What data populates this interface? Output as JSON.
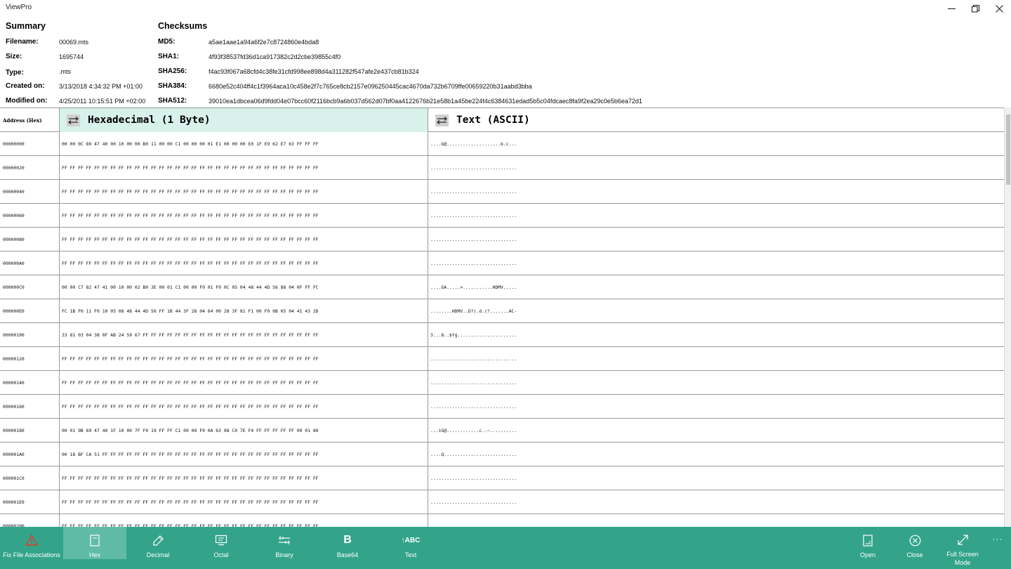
{
  "window": {
    "title": "ViewPro"
  },
  "summary": {
    "heading": "Summary",
    "fields": [
      {
        "label": "Filename:",
        "value": "00069.mts"
      },
      {
        "label": "Size:",
        "value": "1695744"
      },
      {
        "label": "Type:",
        "value": ".mts"
      },
      {
        "label": "Created on:",
        "value": "3/13/2018 4:34:32 PM +01:00"
      },
      {
        "label": "Modified on:",
        "value": "4/25/2011 10:15:51 PM +02:00"
      }
    ]
  },
  "checksums": {
    "heading": "Checksums",
    "fields": [
      {
        "label": "MD5:",
        "value": "a5ae1aae1a94a6f2e7c8724860e4bda8"
      },
      {
        "label": "SHA1:",
        "value": "4f93f38537fd36d1ca917382c2d2cbe39855c4f0"
      },
      {
        "label": "SHA256:",
        "value": "f4ac93f067a68cfd4c38fe31cfd998ee898d4a311282f547afe2e437cb81b324"
      },
      {
        "label": "SHA384:",
        "value": "6680e52c404ff4c1f3964aca10c458e2f7c765ce8cb2157e096250445cac4670da732b6709ffe00659220b31aabd3bba"
      },
      {
        "label": "SHA512:",
        "value": "39010ea1dbcea06d9fdd04e07bcc60f2116bcb9a6b037d562d07bf0aa4122676b21e58b1a45be224f4c6384631edad5b5c04fdcaec8fa9f2ea29c0e5b6ea72d1"
      }
    ]
  },
  "grid": {
    "address_header": "Address (Hex)",
    "hex_header": "Hexadecimal (1 Byte)",
    "text_header": "Text (ASCII)",
    "rows": [
      {
        "addr": "00000000",
        "hex": "00 00 0C 89 47 40 00 10 00 00 B0 11 00 00 C1 00 00 00 01 E1 00 00 00 E0 1F E9 62 E7 63 FF FF FF",
        "text": "....G@....................b.c..."
      },
      {
        "addr": "00000020",
        "hex": "FF FF FF FF FF FF FF FF FF FF FF FF FF FF FF FF FF FF FF FF FF FF FF FF FF FF FF FF FF FF FF FF",
        "text": "................................"
      },
      {
        "addr": "00000040",
        "hex": "FF FF FF FF FF FF FF FF FF FF FF FF FF FF FF FF FF FF FF FF FF FF FF FF FF FF FF FF FF FF FF FF",
        "text": "................................"
      },
      {
        "addr": "00000060",
        "hex": "FF FF FF FF FF FF FF FF FF FF FF FF FF FF FF FF FF FF FF FF FF FF FF FF FF FF FF FF FF FF FF FF",
        "text": "................................"
      },
      {
        "addr": "00000080",
        "hex": "FF FF FF FF FF FF FF FF FF FF FF FF FF FF FF FF FF FF FF FF FF FF FF FF FF FF FF FF FF FF FF FF",
        "text": "................................"
      },
      {
        "addr": "000000A0",
        "hex": "FF FF FF FF FF FF FF FF FF FF FF FF FF FF FF FF FF FF FF FF FF FF FF FF FF FF FF FF FF FF FF FF",
        "text": "................................"
      },
      {
        "addr": "000000C0",
        "hex": "00 00 C7 82 47 41 00 10 00 02 B0 3E 00 01 C1 00 00 F0 01 F0 0C 05 04 48 44 4D 56 88 04 0F FF FC",
        "text": "....GA.....>...........HDMV....."
      },
      {
        "addr": "000000E0",
        "hex": "FC 1B F0 11 F0 10 05 08 48 44 4D 56 FF 1B 44 3F 28 04 64 00 28 3F 81 F1 00 F0 0B 05 04 41 43 2D",
        "text": "........HDMV..D?(.d.(?.......AC-"
      },
      {
        "addr": "00000100",
        "hex": "33 81 03 04 38 0F AB 24 59 67 FF FF FF FF FF FF FF FF FF FF FF FF FF FF FF FF FF FF FF FF FF FF",
        "text": "3...8..$Yg......................"
      },
      {
        "addr": "00000120",
        "hex": "FF FF FF FF FF FF FF FF FF FF FF FF FF FF FF FF FF FF FF FF FF FF FF FF FF FF FF FF FF FF FF FF",
        "text": "................................"
      },
      {
        "addr": "00000140",
        "hex": "FF FF FF FF FF FF FF FF FF FF FF FF FF FF FF FF FF FF FF FF FF FF FF FF FF FF FF FF FF FF FF FF",
        "text": "................................"
      },
      {
        "addr": "00000160",
        "hex": "FF FF FF FF FF FF FF FF FF FF FF FF FF FF FF FF FF FF FF FF FF FF FF FF FF FF FF FF FF FF FF FF",
        "text": "................................"
      },
      {
        "addr": "00000180",
        "hex": "00 01 9B 69 47 40 1F 10 00 7F F0 19 FF FF C1 00 00 F0 0A 63 08 C0 7E F4 FF FF FF FF FF 00 01 80",
        "text": "...iG@............c..~.........."
      },
      {
        "addr": "000001A0",
        "hex": "00 18 BF CA 51 FF FF FF FF FF FF FF FF FF FF FF FF FF FF FF FF FF FF FF FF FF FF FF FF FF FF FF",
        "text": "....Q..........................."
      },
      {
        "addr": "000001C0",
        "hex": "FF FF FF FF FF FF FF FF FF FF FF FF FF FF FF FF FF FF FF FF FF FF FF FF FF FF FF FF FF FF FF FF",
        "text": "................................"
      },
      {
        "addr": "000001E0",
        "hex": "FF FF FF FF FF FF FF FF FF FF FF FF FF FF FF FF FF FF FF FF FF FF FF FF FF FF FF FF FF FF FF FF",
        "text": "................................"
      },
      {
        "addr": "00000200",
        "hex": "FF FF FF FF FF FF FF FF FF FF FF FF FF FF FF FF FF FF FF FF FF FF FF FF FF FF FF FF FF FF FF FF",
        "text": "................................"
      }
    ]
  },
  "commands": {
    "fix_assoc": "Fix File Associations",
    "hex": "Hex",
    "decimal": "Decimal",
    "octal": "Octal",
    "binary": "Binary",
    "base64": "Base64",
    "base64_glyph": "B",
    "text": "Text",
    "text_glyph": "↑ABC",
    "open": "Open",
    "close": "Close",
    "fullscreen_line1": "Full Screen",
    "fullscreen_line2": "Mode",
    "more": "···"
  },
  "colors": {
    "accent": "#33a48a",
    "active": "#60bba6",
    "header_hex_bg": "#d8f1ea",
    "warning": "#e03a2a"
  }
}
